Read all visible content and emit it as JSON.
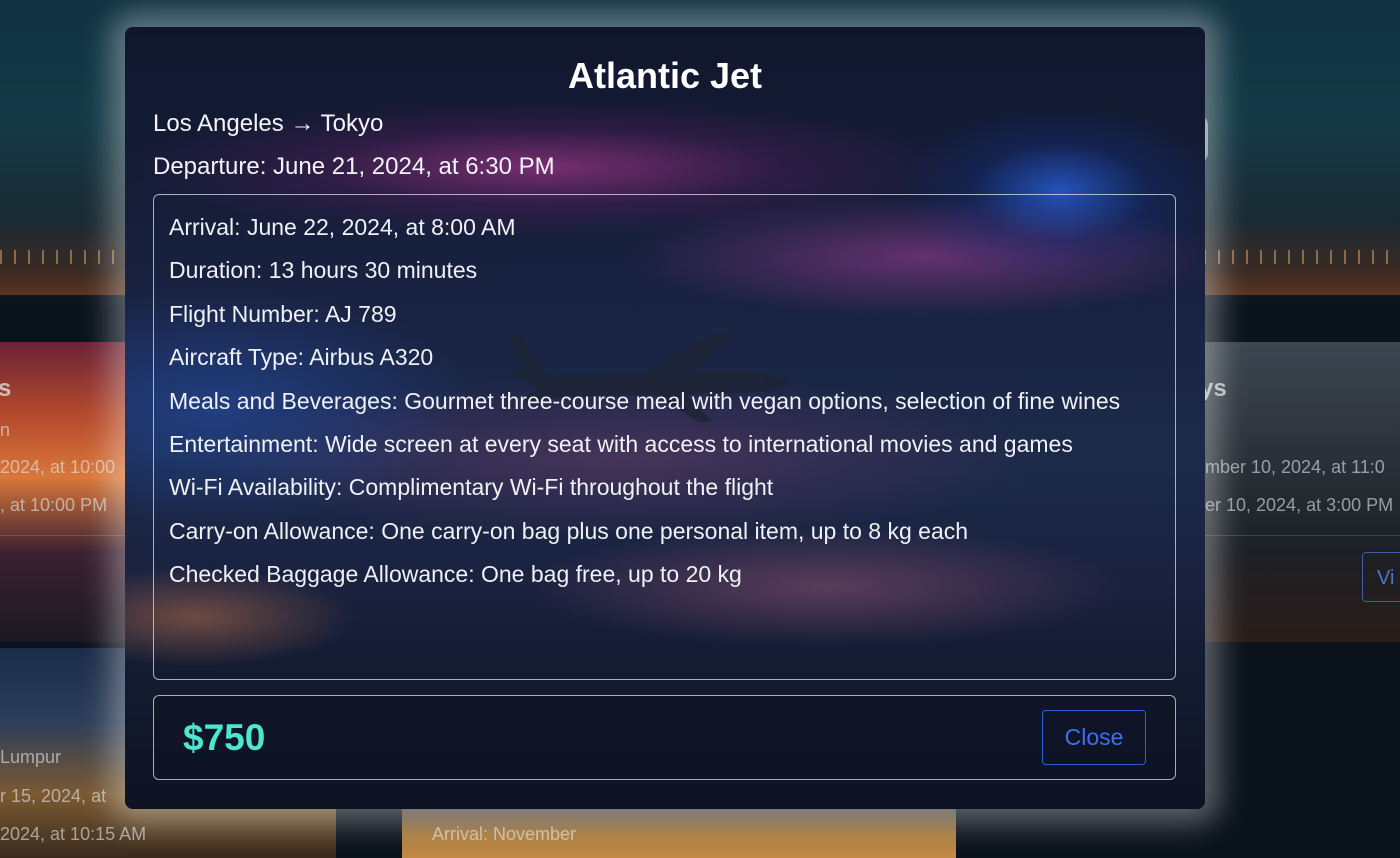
{
  "background": {
    "left_card": {
      "title_fragment": "s",
      "subtitle_fragment": "n",
      "departure_fragment": "2024, at 10:00",
      "arrival_fragment": ", at 10:00 PM"
    },
    "right_card": {
      "title_fragment": "ys",
      "departure_fragment": "mber 10, 2024, at 11:0",
      "arrival_fragment": "er 10, 2024, at 3:00 PM",
      "view_button_fragment": "Vi"
    },
    "bottom_left_card": {
      "city_fragment": "Lumpur",
      "departure_fragment": "r 15, 2024, at",
      "arrival_fragment": "2024, at 10:15 AM"
    },
    "bottom_mid_card": {
      "arrival_fragment": "Arrival: November"
    }
  },
  "modal": {
    "title": "Atlantic Jet",
    "route": "Los Angeles → Tokyo",
    "departure": "Departure: June 21, 2024, at 6:30 PM",
    "details": [
      "Arrival: June 22, 2024, at 8:00 AM",
      "Duration: 13 hours 30 minutes",
      "Flight Number: AJ 789",
      "Aircraft Type: Airbus A320",
      "Meals and Beverages: Gourmet three-course meal with vegan options, selection of fine wines",
      "Entertainment: Wide screen at every seat with access to international movies and games",
      "Wi-Fi Availability: Complimentary Wi-Fi throughout the flight",
      "Carry-on Allowance: One carry-on bag plus one personal item, up to 8 kg each",
      "Checked Baggage Allowance: One bag free, up to 20 kg"
    ],
    "price": "$750",
    "close_label": "Close"
  },
  "colors": {
    "price": "#4fe6cf",
    "close_button": "#3a6ff0",
    "title": "#ffffff"
  }
}
